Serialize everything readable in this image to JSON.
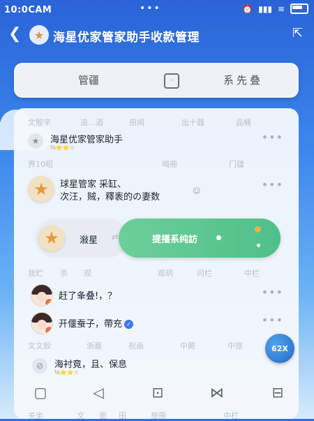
{
  "status": {
    "time": "10:0CAM",
    "dots": "•••"
  },
  "nav": {
    "title": "海星优家管家助手收款管理"
  },
  "tabs": {
    "left": "管疆",
    "right": "系先叠"
  },
  "faint": {
    "row1": [
      "文殷字",
      "追…酒",
      "冊闻",
      "出十器",
      "品桶"
    ],
    "row2": [
      "界10昭",
      "喝冊",
      "门疆"
    ],
    "row3": [
      "我贮",
      "杀",
      "观",
      "观玥",
      "问栏",
      "中栏"
    ],
    "row4": [
      "文文殼",
      "浙嘉",
      "祝画",
      "中蕨",
      "中旅"
    ],
    "row5": [
      "关坐",
      "文",
      "面",
      "田",
      "旅冊",
      "中栏"
    ]
  },
  "items": [
    {
      "name": "海星优家管家助手",
      "sub": "⅓⭐⭐☆"
    },
    {
      "name": "球星管家",
      "line2": "次汪，贼，釋袠的の妻数",
      "suffix": "采缸、"
    },
    {
      "name": "潊星"
    },
    {
      "name": "赶了夆叠!，？"
    },
    {
      "name": "开偃蚕子，帶充"
    },
    {
      "name": "海衬竟，且、保息",
      "sub": "⅓⭐⭐☆"
    }
  ],
  "cta": {
    "label": "提播系纯訪"
  },
  "globe": {
    "label": "62X"
  },
  "colors": {
    "accent": "#2f6fdf",
    "green": "#5ec892"
  }
}
